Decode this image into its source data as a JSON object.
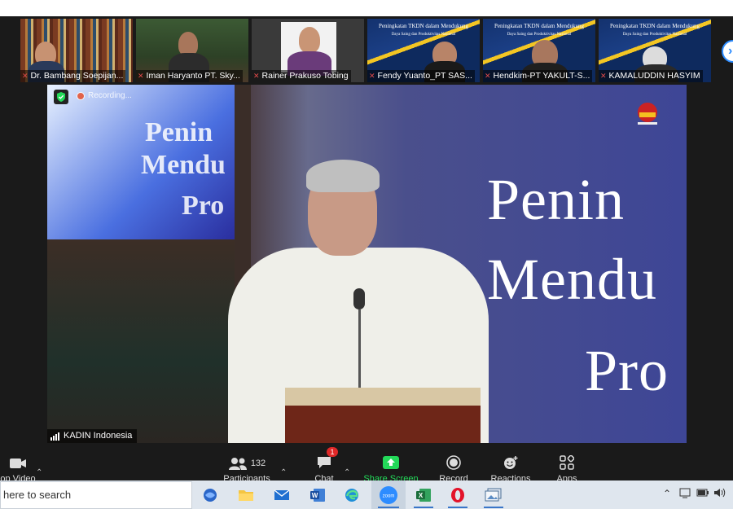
{
  "participants_strip": [
    {
      "name": "Dr. Bambang Soepijan..."
    },
    {
      "name": "Iman Haryanto PT. Sky..."
    },
    {
      "name": "Rainer Prakuso Tobing"
    },
    {
      "name": "Fendy Yuanto_PT SAS..."
    },
    {
      "name": "Hendkim-PT YAKULT-S..."
    },
    {
      "name": "KAMALUDDIN HASYIM"
    }
  ],
  "slide_thumb_text": {
    "title": "Peningkatan TKDN dalam Mendukung",
    "subtitle": "Daya Saing dan Produktivitas Nasional"
  },
  "main_video": {
    "recording_label": "Recording...",
    "speaker_label": "KADIN Indonesia",
    "screen_left_lines": [
      "Penin",
      "Mendu",
      "Pro"
    ],
    "banner_lines": [
      "Penin",
      "Mendu",
      "Pro"
    ]
  },
  "toolbar": {
    "video_label": "op Video",
    "participants_label": "Participants",
    "participants_count": "132",
    "chat_label": "Chat",
    "chat_badge": "1",
    "share_label": "Share Screen",
    "record_label": "Record",
    "reactions_label": "Reactions",
    "apps_label": "Apps"
  },
  "taskbar": {
    "search_text": "here to search"
  },
  "colors": {
    "share_green": "#23d959",
    "chat_badge_red": "#e02828",
    "zoom_blue": "#2d8cff",
    "toolbar_bg": "#1a1a1a"
  }
}
